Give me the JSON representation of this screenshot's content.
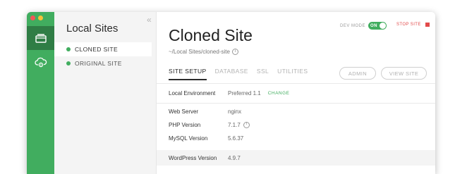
{
  "sidebar": {
    "nav": [
      {
        "icon": "sites-icon",
        "active": true
      },
      {
        "icon": "cloud-icon",
        "active": false
      }
    ]
  },
  "sites_panel": {
    "heading": "Local Sites",
    "collapse_glyph": "«",
    "sites": [
      {
        "name": "CLONED SITE",
        "selected": true
      },
      {
        "name": "ORIGINAL SITE",
        "selected": false
      }
    ]
  },
  "site": {
    "title": "Cloned Site",
    "path": "~/Local Sites/cloned-site",
    "dev_mode_label": "DEV MODE",
    "dev_mode_state": "ON",
    "stop_label": "STOP SITE"
  },
  "tabs": [
    {
      "label": "SITE SETUP",
      "active": true
    },
    {
      "label": "DATABASE",
      "active": false
    },
    {
      "label": "SSL",
      "active": false
    },
    {
      "label": "UTILITIES",
      "active": false
    }
  ],
  "buttons": {
    "admin": "ADMIN",
    "view_site": "VIEW SITE"
  },
  "details": {
    "local_env": {
      "label": "Local Environment",
      "value": "Preferred 1.1",
      "action": "CHANGE"
    },
    "web_server": {
      "label": "Web Server",
      "value": "nginx"
    },
    "php": {
      "label": "PHP Version",
      "value": "7.1.7"
    },
    "mysql": {
      "label": "MySQL Version",
      "value": "5.6.37"
    },
    "wordpress": {
      "label": "WordPress Version",
      "value": "4.9.7"
    }
  },
  "colors": {
    "accent_green": "#41ad5f",
    "rail_active": "#2f7d45",
    "stop_red": "#e24a4a"
  }
}
